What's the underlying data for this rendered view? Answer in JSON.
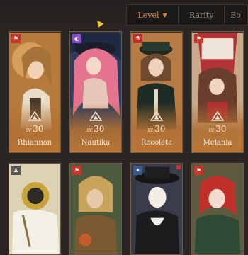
{
  "sort_tabs": [
    {
      "label": "Level",
      "active": true
    },
    {
      "label": "Rarity",
      "active": false
    },
    {
      "label": "Bo",
      "active": false
    }
  ],
  "characters": [
    {
      "name": "Rhiannon",
      "level_prefix": "LV.",
      "level": "30",
      "class_icon": "class-icon",
      "badge_color": "#c3362c"
    },
    {
      "name": "Nautika",
      "level_prefix": "LV.",
      "level": "30",
      "class_icon": "class-icon",
      "badge_color": "#8a4fc0"
    },
    {
      "name": "Recoleta",
      "level_prefix": "LV.",
      "level": "30",
      "class_icon": "class-icon",
      "badge_color": "#b6302a"
    },
    {
      "name": "Melania",
      "level_prefix": "LV.",
      "level": "30",
      "class_icon": "class-icon",
      "badge_color": "#c3362c"
    }
  ],
  "colors": {
    "accent": "#d88b37",
    "card_gold": "#b77636",
    "background": "#2b2623"
  }
}
